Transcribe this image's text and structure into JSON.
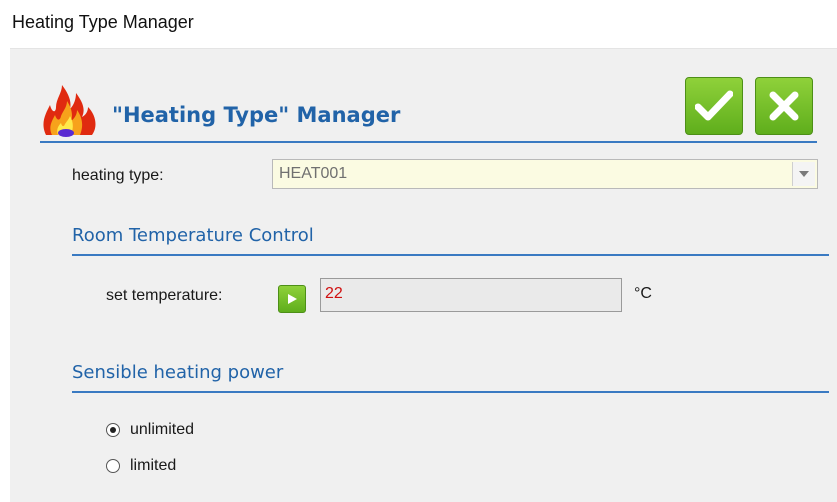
{
  "window": {
    "title": "Heating Type Manager"
  },
  "header": {
    "title": "\"Heating Type\" Manager",
    "icon": "flame-icon",
    "ok_icon": "checkmark-icon",
    "cancel_icon": "close-icon"
  },
  "heating_type": {
    "label": "heating type:",
    "selected": "HEAT001"
  },
  "room_temperature": {
    "heading": "Room Temperature Control",
    "set_label": "set temperature:",
    "value": "22",
    "unit": "°C"
  },
  "sensible_power": {
    "heading": "Sensible heating power",
    "options": [
      {
        "label": "unlimited",
        "checked": true
      },
      {
        "label": "limited",
        "checked": false
      }
    ]
  },
  "colors": {
    "accent": "#2163a8",
    "button_green": "#6cbf22",
    "combo_bg": "#fbfbe2",
    "value_red": "#d01010"
  }
}
